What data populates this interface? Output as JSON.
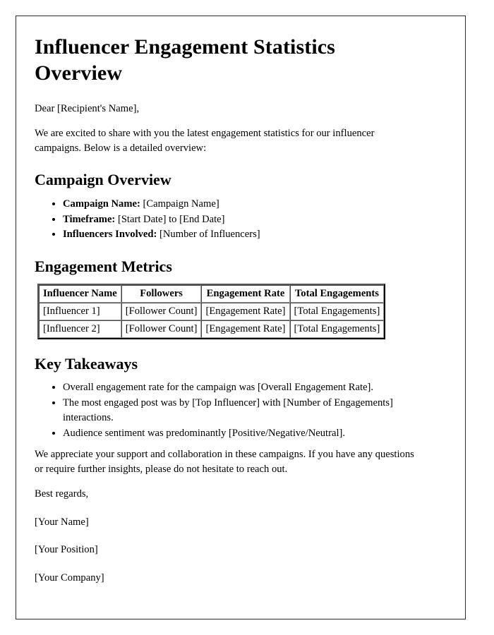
{
  "document": {
    "title": "Influencer Engagement Statistics Overview",
    "salutation": "Dear [Recipient's Name],",
    "intro": "We are excited to share with you the latest engagement statistics for our influencer campaigns. Below is a detailed overview:"
  },
  "campaign_overview": {
    "heading": "Campaign Overview",
    "items": [
      {
        "label": "Campaign Name:",
        "value": "[Campaign Name]"
      },
      {
        "label": "Timeframe:",
        "value": "[Start Date] to [End Date]"
      },
      {
        "label": "Influencers Involved:",
        "value": "[Number of Influencers]"
      }
    ]
  },
  "engagement_metrics": {
    "heading": "Engagement Metrics",
    "table": {
      "columns": [
        "Influencer Name",
        "Followers",
        "Engagement Rate",
        "Total Engagements"
      ],
      "rows": [
        [
          "[Influencer 1]",
          "[Follower Count]",
          "[Engagement Rate]",
          "[Total Engagements]"
        ],
        [
          "[Influencer 2]",
          "[Follower Count]",
          "[Engagement Rate]",
          "[Total Engagements]"
        ]
      ]
    }
  },
  "key_takeaways": {
    "heading": "Key Takeaways",
    "items": [
      "Overall engagement rate for the campaign was [Overall Engagement Rate].",
      "The most engaged post was by [Top Influencer] with [Number of Engagements] interactions.",
      "Audience sentiment was predominantly [Positive/Negative/Neutral]."
    ]
  },
  "closing": {
    "paragraph": "We appreciate your support and collaboration in these campaigns. If you have any questions or require further insights, please do not hesitate to reach out.",
    "regards": "Best regards,",
    "name": "[Your Name]",
    "position": "[Your Position]",
    "company": "[Your Company]"
  }
}
